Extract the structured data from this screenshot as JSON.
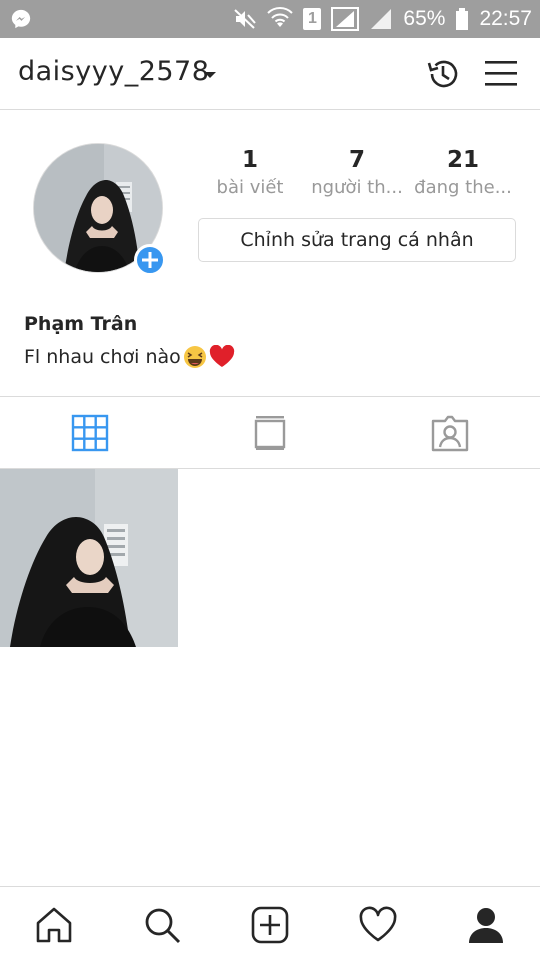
{
  "status_bar": {
    "battery_text": "65%",
    "time": "22:57",
    "sim_label": "1",
    "background": "#9e9e9e"
  },
  "header": {
    "username": "daisyyy_2578"
  },
  "profile": {
    "stats": [
      {
        "count": "1",
        "label": "bài viết"
      },
      {
        "count": "7",
        "label": "người th..."
      },
      {
        "count": "21",
        "label": "đang the..."
      }
    ],
    "edit_button_label": "Chỉnh sửa trang cá nhân",
    "full_name": "Phạm Trân",
    "bio": "Fl nhau chơi nào"
  },
  "tabs": {
    "active": "grid",
    "items": [
      "grid-icon",
      "feed-icon",
      "tagged-icon"
    ],
    "active_color": "#3897f0"
  },
  "bottom_nav": {
    "items": [
      "home-icon",
      "search-icon",
      "add-post-icon",
      "activity-heart-icon",
      "profile-icon"
    ],
    "active": "profile-icon"
  },
  "colors": {
    "accent": "#3897f0",
    "border": "#dbdbdb",
    "text": "#262626",
    "muted": "#999999"
  }
}
